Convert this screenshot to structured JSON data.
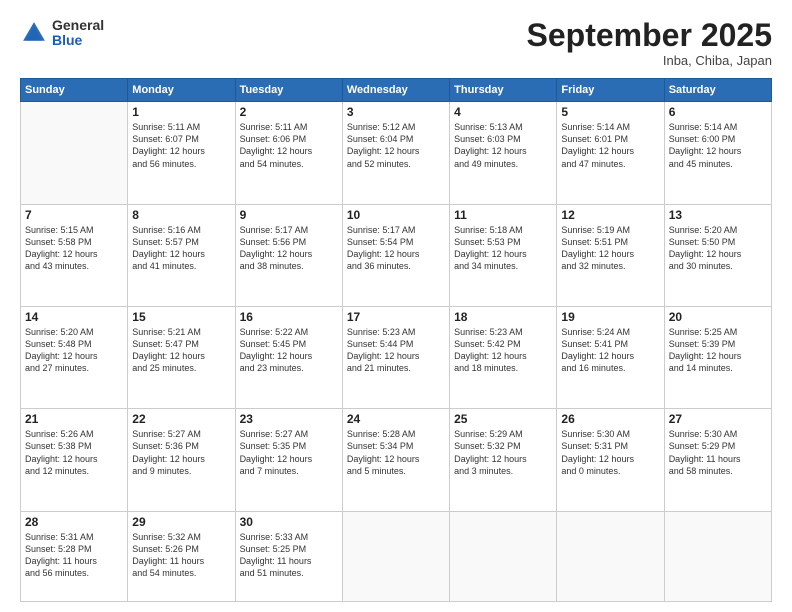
{
  "header": {
    "logo": {
      "general": "General",
      "blue": "Blue"
    },
    "title": "September 2025",
    "location": "Inba, Chiba, Japan"
  },
  "days_of_week": [
    "Sunday",
    "Monday",
    "Tuesday",
    "Wednesday",
    "Thursday",
    "Friday",
    "Saturday"
  ],
  "weeks": [
    [
      {
        "day": "",
        "info": ""
      },
      {
        "day": "1",
        "info": "Sunrise: 5:11 AM\nSunset: 6:07 PM\nDaylight: 12 hours\nand 56 minutes."
      },
      {
        "day": "2",
        "info": "Sunrise: 5:11 AM\nSunset: 6:06 PM\nDaylight: 12 hours\nand 54 minutes."
      },
      {
        "day": "3",
        "info": "Sunrise: 5:12 AM\nSunset: 6:04 PM\nDaylight: 12 hours\nand 52 minutes."
      },
      {
        "day": "4",
        "info": "Sunrise: 5:13 AM\nSunset: 6:03 PM\nDaylight: 12 hours\nand 49 minutes."
      },
      {
        "day": "5",
        "info": "Sunrise: 5:14 AM\nSunset: 6:01 PM\nDaylight: 12 hours\nand 47 minutes."
      },
      {
        "day": "6",
        "info": "Sunrise: 5:14 AM\nSunset: 6:00 PM\nDaylight: 12 hours\nand 45 minutes."
      }
    ],
    [
      {
        "day": "7",
        "info": "Sunrise: 5:15 AM\nSunset: 5:58 PM\nDaylight: 12 hours\nand 43 minutes."
      },
      {
        "day": "8",
        "info": "Sunrise: 5:16 AM\nSunset: 5:57 PM\nDaylight: 12 hours\nand 41 minutes."
      },
      {
        "day": "9",
        "info": "Sunrise: 5:17 AM\nSunset: 5:56 PM\nDaylight: 12 hours\nand 38 minutes."
      },
      {
        "day": "10",
        "info": "Sunrise: 5:17 AM\nSunset: 5:54 PM\nDaylight: 12 hours\nand 36 minutes."
      },
      {
        "day": "11",
        "info": "Sunrise: 5:18 AM\nSunset: 5:53 PM\nDaylight: 12 hours\nand 34 minutes."
      },
      {
        "day": "12",
        "info": "Sunrise: 5:19 AM\nSunset: 5:51 PM\nDaylight: 12 hours\nand 32 minutes."
      },
      {
        "day": "13",
        "info": "Sunrise: 5:20 AM\nSunset: 5:50 PM\nDaylight: 12 hours\nand 30 minutes."
      }
    ],
    [
      {
        "day": "14",
        "info": "Sunrise: 5:20 AM\nSunset: 5:48 PM\nDaylight: 12 hours\nand 27 minutes."
      },
      {
        "day": "15",
        "info": "Sunrise: 5:21 AM\nSunset: 5:47 PM\nDaylight: 12 hours\nand 25 minutes."
      },
      {
        "day": "16",
        "info": "Sunrise: 5:22 AM\nSunset: 5:45 PM\nDaylight: 12 hours\nand 23 minutes."
      },
      {
        "day": "17",
        "info": "Sunrise: 5:23 AM\nSunset: 5:44 PM\nDaylight: 12 hours\nand 21 minutes."
      },
      {
        "day": "18",
        "info": "Sunrise: 5:23 AM\nSunset: 5:42 PM\nDaylight: 12 hours\nand 18 minutes."
      },
      {
        "day": "19",
        "info": "Sunrise: 5:24 AM\nSunset: 5:41 PM\nDaylight: 12 hours\nand 16 minutes."
      },
      {
        "day": "20",
        "info": "Sunrise: 5:25 AM\nSunset: 5:39 PM\nDaylight: 12 hours\nand 14 minutes."
      }
    ],
    [
      {
        "day": "21",
        "info": "Sunrise: 5:26 AM\nSunset: 5:38 PM\nDaylight: 12 hours\nand 12 minutes."
      },
      {
        "day": "22",
        "info": "Sunrise: 5:27 AM\nSunset: 5:36 PM\nDaylight: 12 hours\nand 9 minutes."
      },
      {
        "day": "23",
        "info": "Sunrise: 5:27 AM\nSunset: 5:35 PM\nDaylight: 12 hours\nand 7 minutes."
      },
      {
        "day": "24",
        "info": "Sunrise: 5:28 AM\nSunset: 5:34 PM\nDaylight: 12 hours\nand 5 minutes."
      },
      {
        "day": "25",
        "info": "Sunrise: 5:29 AM\nSunset: 5:32 PM\nDaylight: 12 hours\nand 3 minutes."
      },
      {
        "day": "26",
        "info": "Sunrise: 5:30 AM\nSunset: 5:31 PM\nDaylight: 12 hours\nand 0 minutes."
      },
      {
        "day": "27",
        "info": "Sunrise: 5:30 AM\nSunset: 5:29 PM\nDaylight: 11 hours\nand 58 minutes."
      }
    ],
    [
      {
        "day": "28",
        "info": "Sunrise: 5:31 AM\nSunset: 5:28 PM\nDaylight: 11 hours\nand 56 minutes."
      },
      {
        "day": "29",
        "info": "Sunrise: 5:32 AM\nSunset: 5:26 PM\nDaylight: 11 hours\nand 54 minutes."
      },
      {
        "day": "30",
        "info": "Sunrise: 5:33 AM\nSunset: 5:25 PM\nDaylight: 11 hours\nand 51 minutes."
      },
      {
        "day": "",
        "info": ""
      },
      {
        "day": "",
        "info": ""
      },
      {
        "day": "",
        "info": ""
      },
      {
        "day": "",
        "info": ""
      }
    ]
  ]
}
